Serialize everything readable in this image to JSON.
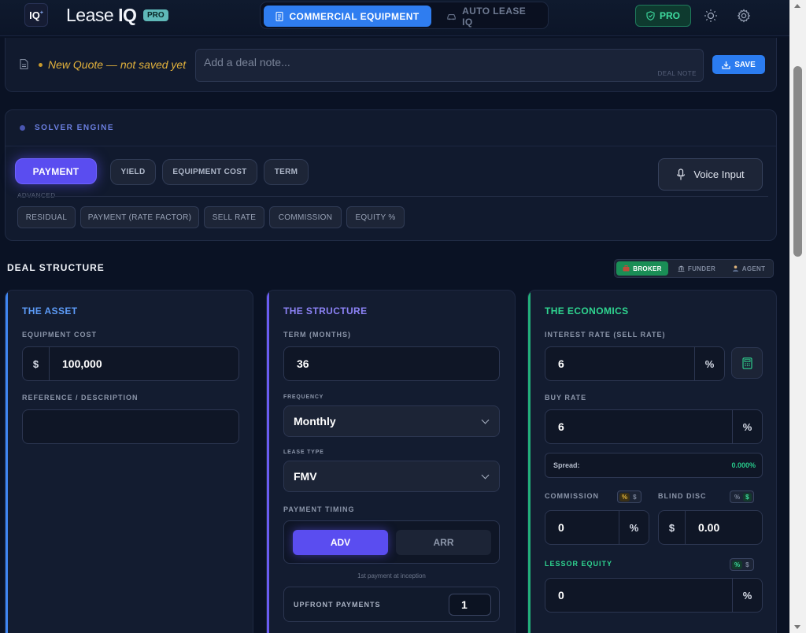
{
  "app": {
    "logo": "IQ",
    "brand_light": "Lease ",
    "brand_bold": "IQ",
    "pro_badge": "PRO"
  },
  "modes": {
    "active": "COMMERCIAL EQUIPMENT",
    "inactive": "AUTO LEASE IQ"
  },
  "header": {
    "pro_label": "PRO"
  },
  "note_bar": {
    "status": "New Quote — not saved yet",
    "placeholder": "Add a deal note...",
    "tag": "DEAL NOTE",
    "save_label": "SAVE"
  },
  "solver": {
    "title": "SOLVER ENGINE",
    "primary": [
      "PAYMENT",
      "YIELD",
      "EQUIPMENT COST",
      "TERM"
    ],
    "advanced_label": "ADVANCED",
    "advanced": [
      "RESIDUAL",
      "PAYMENT (RATE FACTOR)",
      "SELL RATE",
      "COMMISSION",
      "EQUITY %"
    ],
    "voice_label": "Voice Input",
    "selected": "PAYMENT"
  },
  "deal": {
    "title": "DEAL STRUCTURE",
    "roles": [
      "BROKER",
      "FUNDER",
      "AGENT"
    ],
    "active_role": "BROKER"
  },
  "asset": {
    "title": "THE ASSET",
    "cost_label": "EQUIPMENT COST",
    "cost_prefix": "$",
    "cost_value": "100,000",
    "ref_label": "REFERENCE / DESCRIPTION",
    "ref_value": ""
  },
  "structure": {
    "title": "THE STRUCTURE",
    "term_label": "TERM (MONTHS)",
    "term_value": "36",
    "frequency_label": "FREQUENCY",
    "frequency_value": "Monthly",
    "lease_type_label": "LEASE TYPE",
    "lease_type_value": "FMV",
    "timing_label": "PAYMENT TIMING",
    "timing_on": "ADV",
    "timing_off": "ARR",
    "timing_hint": "1st payment at inception",
    "upfront_label": "UPFRONT PAYMENTS",
    "upfront_value": "1"
  },
  "economics": {
    "title": "THE ECONOMICS",
    "interest_label": "INTEREST RATE (SELL RATE)",
    "interest_value": "6",
    "interest_suffix": "%",
    "buy_label": "BUY RATE",
    "buy_value": "6",
    "buy_suffix": "%",
    "spread_label": "Spread:",
    "spread_value": "0.000%",
    "commission_label": "COMMISSION",
    "commission_value": "0",
    "commission_suffix": "%",
    "blind_label": "BLIND DISC",
    "blind_prefix": "$",
    "blind_value": "0.00",
    "equity_label": "LESSOR EQUITY",
    "equity_value": "0",
    "equity_suffix": "%",
    "toggle_pct": "%",
    "toggle_usd": "$"
  },
  "colors": {
    "accent_blue": "#2f7df0",
    "accent_purple": "#5a4df0",
    "accent_green": "#22b07a",
    "note_gold": "#e3b23c"
  }
}
